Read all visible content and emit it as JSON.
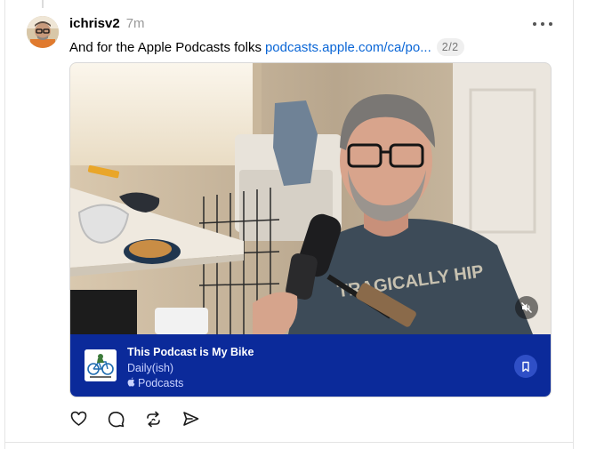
{
  "post": {
    "username": "ichrisv2",
    "timestamp": "7m",
    "text": "And for the Apple Podcasts folks",
    "link_text": "podcasts.apple.com/ca/po...",
    "page_indicator": "2/2"
  },
  "media": {
    "video_shirt_text": "TRAGICALLY HIP",
    "mute_icon": "speaker-muted-icon"
  },
  "podcast_card": {
    "title": "This Podcast is My Bike",
    "subtitle": "Daily(ish)",
    "source_label": "Podcasts",
    "source_icon": "apple-logo-icon",
    "save_icon": "bookmark-icon",
    "bar_color": "#0b2a9a"
  },
  "actions": {
    "icons": [
      "heart-icon",
      "comment-icon",
      "repost-icon",
      "share-icon"
    ]
  },
  "colors": {
    "link": "#0a66d6",
    "muted_text": "#999999"
  }
}
